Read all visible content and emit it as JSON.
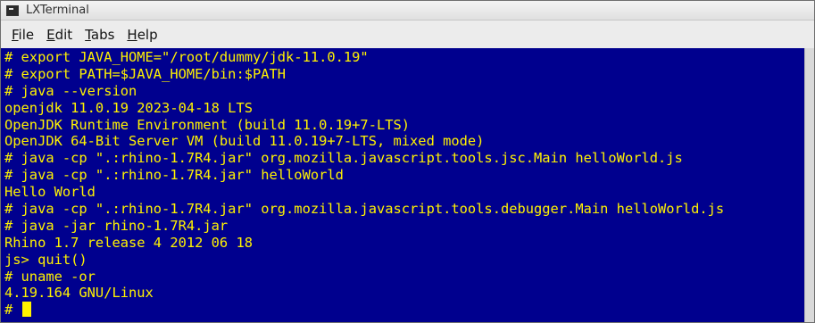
{
  "window": {
    "title": "LXTerminal"
  },
  "menubar": {
    "items": [
      {
        "mnemonic": "F",
        "rest": "ile"
      },
      {
        "mnemonic": "E",
        "rest": "dit"
      },
      {
        "mnemonic": "T",
        "rest": "abs"
      },
      {
        "mnemonic": "H",
        "rest": "elp"
      }
    ]
  },
  "terminal": {
    "colors": {
      "background": "#00008e",
      "foreground": "#fff200"
    },
    "lines": [
      "# export JAVA_HOME=\"/root/dummy/jdk-11.0.19\"",
      "# export PATH=$JAVA_HOME/bin:$PATH",
      "# java --version",
      "openjdk 11.0.19 2023-04-18 LTS",
      "OpenJDK Runtime Environment (build 11.0.19+7-LTS)",
      "OpenJDK 64-Bit Server VM (build 11.0.19+7-LTS, mixed mode)",
      "# java -cp \".:rhino-1.7R4.jar\" org.mozilla.javascript.tools.jsc.Main helloWorld.js",
      "# java -cp \".:rhino-1.7R4.jar\" helloWorld",
      "Hello World",
      "# java -cp \".:rhino-1.7R4.jar\" org.mozilla.javascript.tools.debugger.Main helloWorld.js",
      "# java -jar rhino-1.7R4.jar",
      "Rhino 1.7 release 4 2012 06 18",
      "js> quit()",
      "# uname -or",
      "4.19.164 GNU/Linux"
    ],
    "prompt": "# "
  }
}
